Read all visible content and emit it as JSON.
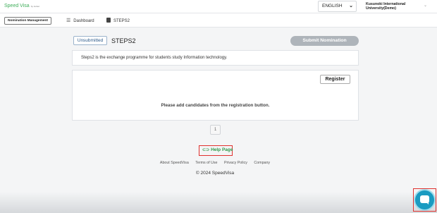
{
  "header": {
    "brand": "Speed Visa",
    "brand_sub": "by Jetnet",
    "language": "ENGLISH",
    "organization": "Kusunoki International University(Demo)"
  },
  "subnav": {
    "nomination_button": "Nomination Management",
    "items": [
      {
        "label": "Dashboard",
        "icon": "list-icon"
      },
      {
        "label": "STEPS2",
        "icon": "clipboard-icon"
      }
    ]
  },
  "main": {
    "status": "Unsubmitted",
    "title": "STEPS2",
    "submit_label": "Submit Nomination",
    "description": "Steps2 is the exchange programme for students study Information technology.",
    "register_label": "Register",
    "empty_message": "Please add candidates from the registration button.",
    "page": "1"
  },
  "footer": {
    "help_label": "Help Page",
    "links": [
      "About SpeedVisa",
      "Terms of Use",
      "Privacy Policy",
      "Company"
    ],
    "copyright": "© 2024 SpeedVisa"
  },
  "colors": {
    "accent_green": "#3fae5a",
    "submit_disabled": "#aeb4ba",
    "chat_blue": "#1a9bc1",
    "highlight_red": "#e0322f"
  }
}
